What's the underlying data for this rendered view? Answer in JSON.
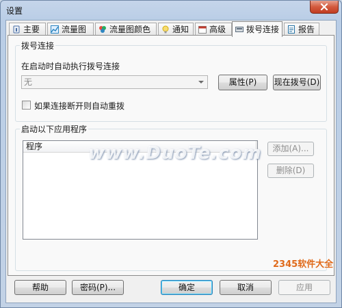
{
  "window": {
    "title": "设置"
  },
  "tabs": [
    {
      "label": "主要",
      "icon": "main-icon",
      "color": "#4a6fa5"
    },
    {
      "label": "流量图",
      "icon": "graph-icon",
      "color": "#2e86c1"
    },
    {
      "label": "流量图颜色",
      "icon": "palette-icon",
      "color": "#d35400"
    },
    {
      "label": "通知",
      "icon": "bulb-icon",
      "color": "#f1c40f"
    },
    {
      "label": "高级",
      "icon": "calendar-icon",
      "color": "#c0392b"
    },
    {
      "label": "拨号连接",
      "icon": "dialup-icon",
      "color": "#5d6d7e",
      "active": true
    },
    {
      "label": "报告",
      "icon": "report-icon",
      "color": "#2471a3"
    }
  ],
  "dialup": {
    "group_title": "拨号连接",
    "auto_label": "在启动时自动执行拨号连接",
    "combo_value": "无",
    "properties_button": "属性(P)",
    "dial_now_button": "现在拨号(D)",
    "redial_checkbox": "如果连接断开则自动重拨",
    "redial_checked": false
  },
  "apps": {
    "group_title": "启动以下应用程序",
    "column_header": "程序",
    "rows": [],
    "add_button": "添加(A)...",
    "remove_button": "删除(D)"
  },
  "footer": {
    "help_button": "帮助",
    "password_button": "密码(P)...",
    "ok_button": "确定",
    "cancel_button": "取消",
    "apply_button": "应用"
  },
  "watermark": {
    "text": "www.DuoTe.com",
    "logo_text": "2345软件大全"
  }
}
